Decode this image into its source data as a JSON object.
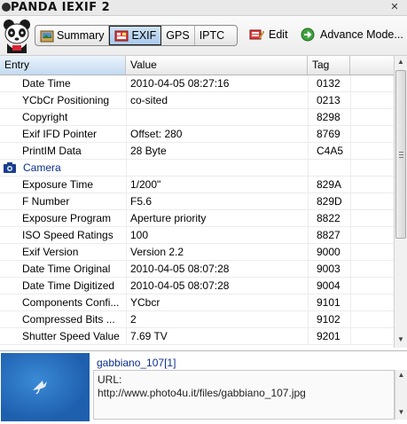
{
  "window": {
    "title": "PANDA IEXIF 2"
  },
  "toolbar": {
    "tabs": [
      {
        "label": "Summary",
        "icon": "summary-icon",
        "active": false
      },
      {
        "label": "EXIF",
        "icon": "exif-icon",
        "active": true
      },
      {
        "label": "GPS",
        "active": false
      },
      {
        "label": "IPTC",
        "active": false
      }
    ],
    "edit_label": "Edit",
    "advance_label": "Advance Mode..."
  },
  "table": {
    "columns": [
      "Entry",
      "Value",
      "Tag"
    ],
    "rows": [
      {
        "entry": "Date Time",
        "value": "2010-04-05 08:27:16",
        "tag": "0132"
      },
      {
        "entry": "YCbCr Positioning",
        "value": "co-sited",
        "tag": "0213"
      },
      {
        "entry": "Copyright",
        "value": "",
        "tag": "8298"
      },
      {
        "entry": "Exif IFD Pointer",
        "value": "Offset: 280",
        "tag": "8769"
      },
      {
        "entry": "PrintIM Data",
        "value": "28 Byte",
        "tag": "C4A5"
      },
      {
        "group": "Camera"
      },
      {
        "entry": "Exposure Time",
        "value": "1/200\"",
        "tag": "829A"
      },
      {
        "entry": "F Number",
        "value": "F5.6",
        "tag": "829D"
      },
      {
        "entry": "Exposure Program",
        "value": "Aperture priority",
        "tag": "8822"
      },
      {
        "entry": "ISO Speed Ratings",
        "value": "100",
        "tag": "8827"
      },
      {
        "entry": "Exif Version",
        "value": "Version 2.2",
        "tag": "9000"
      },
      {
        "entry": "Date Time Original",
        "value": "2010-04-05 08:07:28",
        "tag": "9003"
      },
      {
        "entry": "Date Time Digitized",
        "value": "2010-04-05 08:07:28",
        "tag": "9004"
      },
      {
        "entry": "Components Confi...",
        "value": "YCbcr",
        "tag": "9101"
      },
      {
        "entry": "Compressed Bits ...",
        "value": "2",
        "tag": "9102"
      },
      {
        "entry": "Shutter Speed Value",
        "value": "7.69 TV",
        "tag": "9201"
      }
    ]
  },
  "preview": {
    "filename": "gabbiano_107[1]",
    "url_label": "URL:",
    "url": "http://www.photo4u.it/files/gabbiano_107.jpg"
  },
  "colors": {
    "accent": "#0b2f8a",
    "active_tab": "#a9c9ec",
    "thumbnail_sky": "#1e5fae"
  }
}
